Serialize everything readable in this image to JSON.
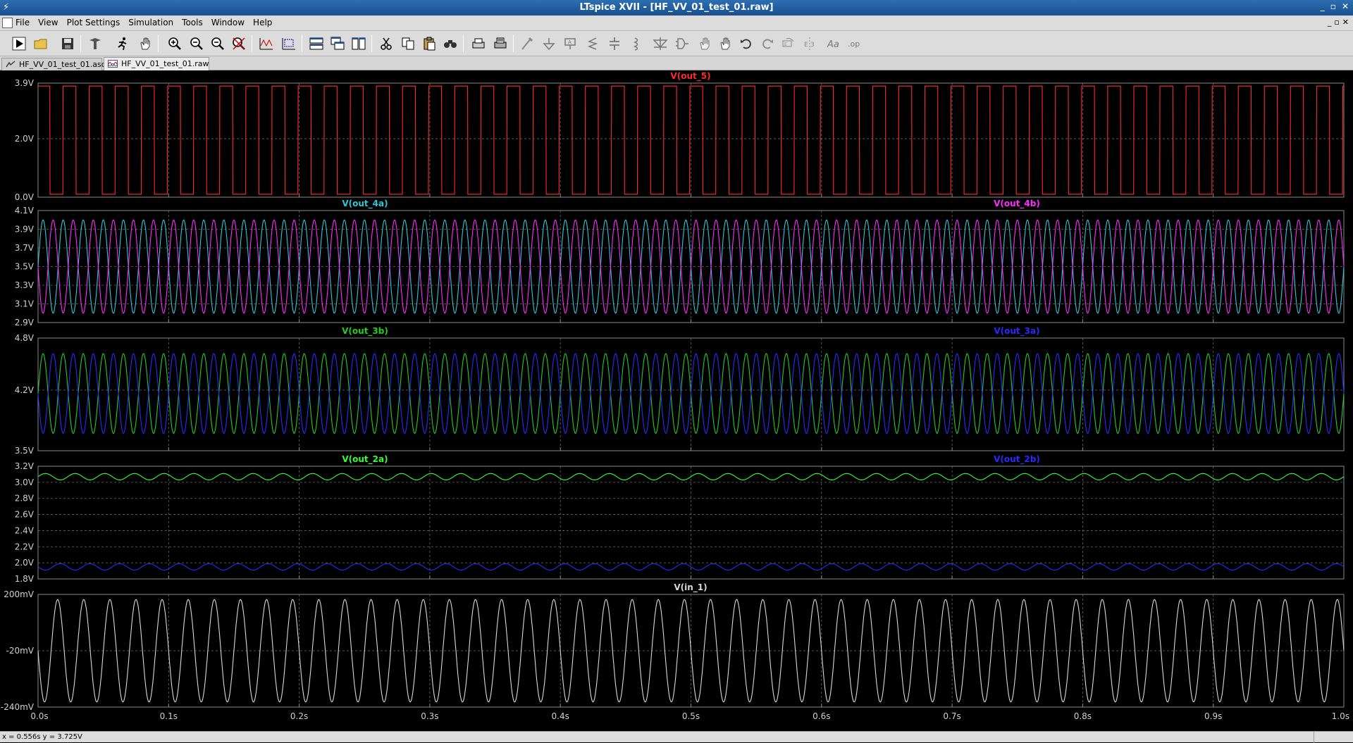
{
  "window": {
    "title": "LTspice XVII - [HF_VV_01_test_01.raw]",
    "buttons": [
      "_",
      "▫",
      "✕"
    ]
  },
  "menu": {
    "items": [
      "File",
      "View",
      "Plot Settings",
      "Simulation",
      "Tools",
      "Window",
      "Help"
    ],
    "mdi_buttons": [
      "_",
      "▫",
      "✕"
    ]
  },
  "tabs": [
    {
      "label": "HF_VV_01_test_01.asc",
      "icon": "schematic-icon",
      "active": false
    },
    {
      "label": "HF_VV_01_test_01.raw",
      "icon": "waveform-icon",
      "active": true
    }
  ],
  "toolbar_icons": [
    "run-icon",
    "open-icon",
    "save-icon",
    "control-panel-icon",
    "halt-icon",
    "pan-icon",
    "zoom-in-icon",
    "zoom-out-icon",
    "zoom-fit-icon",
    "zoom-cancel-icon",
    "autorange-icon",
    "zoom-rect-icon",
    "tile-horizontal-icon",
    "cascade-icon",
    "tile-vertical-icon",
    "cut-icon",
    "copy-icon",
    "paste-icon",
    "find-icon",
    "print-preview-icon",
    "print-icon",
    "wire-icon",
    "ground-icon",
    "label-net-icon",
    "resistor-icon",
    "capacitor-icon",
    "inductor-icon",
    "diode-icon",
    "component-icon",
    "move-icon",
    "drag-icon",
    "undo-icon",
    "redo-icon",
    "rotate-icon",
    "mirror-icon",
    "text-icon",
    "spice-directive-icon"
  ],
  "colors": {
    "red": "#ff2a2a",
    "cyan": "#2ec7d6",
    "magenta": "#ff2aff",
    "green": "#22cc22",
    "lime": "#33ff33",
    "blue": "#2a2aff",
    "white": "#d8d8d8",
    "grid": "#6a6a6a"
  },
  "chart_data": [
    {
      "type": "line",
      "series": [
        {
          "name": "V(out_5)",
          "color": "red",
          "shape": "square",
          "cycles": 50,
          "low": 0.1,
          "high": 3.8
        }
      ],
      "yticks": [
        "3.9V",
        "2.0V",
        "0.0V"
      ],
      "ytick_values": [
        3.9,
        2.0,
        0.0
      ],
      "ylim": [
        0.0,
        3.9
      ]
    },
    {
      "type": "line",
      "series": [
        {
          "name": "V(out_4a)",
          "color": "cyan",
          "shape": "sine",
          "cycles": 65,
          "center": 3.5,
          "amp": 0.5,
          "phase": 0.0
        },
        {
          "name": "V(out_4b)",
          "color": "magenta",
          "shape": "sine",
          "cycles": 65,
          "center": 3.5,
          "amp": 0.5,
          "phase": 3.14159
        }
      ],
      "yticks": [
        "4.1V",
        "3.9V",
        "3.7V",
        "3.5V",
        "3.3V",
        "3.1V",
        "2.9V"
      ],
      "ytick_values": [
        4.1,
        3.9,
        3.7,
        3.5,
        3.3,
        3.1,
        2.9
      ],
      "ylim": [
        2.9,
        4.1
      ]
    },
    {
      "type": "line",
      "series": [
        {
          "name": "V(out_3b)",
          "color": "green",
          "shape": "sine",
          "cycles": 65,
          "center": 4.16,
          "amp": 0.46,
          "phase": 0.0
        },
        {
          "name": "V(out_3a)",
          "color": "blue",
          "shape": "sine",
          "cycles": 65,
          "center": 4.16,
          "amp": 0.46,
          "phase": 3.14159
        }
      ],
      "yticks": [
        "4.8V",
        "4.2V",
        "3.5V"
      ],
      "ytick_values": [
        4.8,
        4.2,
        3.5
      ],
      "ylim": [
        3.5,
        4.8
      ]
    },
    {
      "type": "line",
      "series": [
        {
          "name": "V(out_2a)",
          "color": "lime",
          "shape": "sine",
          "cycles": 44,
          "center": 3.07,
          "amp": 0.04,
          "phase": 0.0
        },
        {
          "name": "V(out_2b)",
          "color": "blue",
          "shape": "sine",
          "cycles": 44,
          "center": 1.95,
          "amp": 0.04,
          "phase": 3.14159
        }
      ],
      "yticks": [
        "3.2V",
        "3.0V",
        "2.8V",
        "2.6V",
        "2.4V",
        "2.2V",
        "2.0V",
        "1.8V"
      ],
      "ytick_values": [
        3.2,
        3.0,
        2.8,
        2.6,
        2.4,
        2.2,
        2.0,
        1.8
      ],
      "ylim": [
        1.8,
        3.2
      ]
    },
    {
      "type": "line",
      "series": [
        {
          "name": "V(in_1)",
          "color": "white",
          "shape": "sine",
          "cycles": 50,
          "center": -20,
          "amp": 200,
          "phase": 3.14159
        }
      ],
      "yticks": [
        "200mV",
        "-20mV",
        "-240mV"
      ],
      "ytick_values": [
        200,
        -20,
        -240
      ],
      "ylim": [
        -240,
        200
      ]
    }
  ],
  "xaxis": {
    "ticks": [
      "0.0s",
      "0.1s",
      "0.2s",
      "0.3s",
      "0.4s",
      "0.5s",
      "0.6s",
      "0.7s",
      "0.8s",
      "0.9s",
      "1.0s"
    ],
    "xlim": [
      0.0,
      1.0
    ]
  },
  "status": {
    "text": "x = 0.556s   y = 3.725V"
  }
}
